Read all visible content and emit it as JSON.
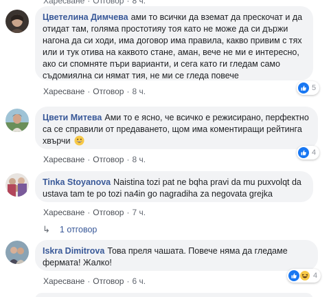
{
  "top": {
    "like": "Харесване",
    "reply": "Отговор",
    "time": "8 ч.",
    "sep": "·"
  },
  "comments": [
    {
      "author": "Цветелина Димчева",
      "text": "ами то всички да вземат да прескочат и да отидат там, голяма простотияу тоя като не може да си държи нагона да си ходи, има договор има правила, какво привим с тях или и тук отива на каквото стане, аман, вече не ми е интересно, ако си спомняте пъри варианти, и сега като ги гледам само съдомиялна си нямат тия, не ми се гледа повече",
      "like": "Харесване",
      "reply": "Отговор",
      "time": "8 ч.",
      "sep": "·",
      "reactions": "5"
    },
    {
      "author": "Цвети Митева",
      "text": "Ами то е ясно, че всичко е режисирано, перфектно са се справили от предаването, щом има коментиращи рейтинга хвърчи",
      "emoji": "grinning-emoji",
      "like": "Харесване",
      "reply": "Отговор",
      "time": "8 ч.",
      "sep": "·",
      "reactions": "4"
    },
    {
      "author": "Tinka Stoyanova",
      "text": "Naistina tozi pat ne bqha pravi da mu puxvolqt da ustava tam te po tozi na4in go nagradiha za negovata grejka",
      "like": "Харесване",
      "reply": "Отговор",
      "time": "7 ч.",
      "sep": "·"
    },
    {
      "author": "Iskra Dimitrova",
      "text": "Това преля чашата. Повече няма да гледаме фермата! Жалко!",
      "like": "Харесване",
      "reply": "Отговор",
      "time": "6 ч.",
      "sep": "·",
      "reactions": "4"
    }
  ],
  "replies_link": "1 отговор",
  "colors": {
    "author": "#385898",
    "bubble": "#f2f3f5",
    "meta": "#616770",
    "like_blue": "#1877f2"
  },
  "icons": {
    "like": "like-icon",
    "haha": "haha-icon",
    "reply_arrow": "reply-arrow-icon"
  }
}
